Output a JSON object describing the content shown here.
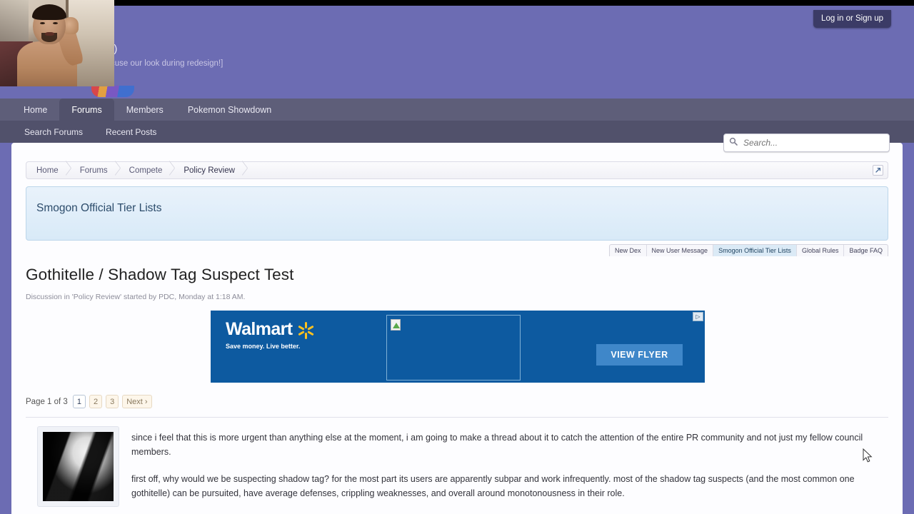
{
  "header": {
    "slogan": ":)",
    "sub_slogan": "cuse our look during redesign!]",
    "login_label": "Log in or Sign up"
  },
  "nav": {
    "tabs": [
      {
        "label": "Home",
        "active": false
      },
      {
        "label": "Forums",
        "active": true
      },
      {
        "label": "Members",
        "active": false
      },
      {
        "label": "Pokemon Showdown",
        "active": false
      }
    ],
    "subnav": [
      {
        "label": "Search Forums"
      },
      {
        "label": "Recent Posts"
      }
    ]
  },
  "search": {
    "placeholder": "Search...",
    "value": "",
    "icon": "search-icon"
  },
  "breadcrumb": {
    "items": [
      {
        "label": "Home"
      },
      {
        "label": "Forums"
      },
      {
        "label": "Compete"
      },
      {
        "label": "Policy Review"
      }
    ],
    "expand_icon": "external-link-icon"
  },
  "notice": {
    "title": "Smogon Official Tier Lists"
  },
  "tier_tabs": [
    {
      "label": "New Dex",
      "active": false
    },
    {
      "label": "New User Message",
      "active": false
    },
    {
      "label": "Smogon Official Tier Lists",
      "active": true
    },
    {
      "label": "Global Rules",
      "active": false
    },
    {
      "label": "Badge FAQ",
      "active": false
    }
  ],
  "thread": {
    "title": "Gothitelle / Shadow Tag Suspect Test",
    "meta": "Discussion in 'Policy Review' started by PDC, Monday at 1:18 AM."
  },
  "ad": {
    "brand": "Walmart",
    "tagline": "Save money. Live better.",
    "button_label": "VIEW FLYER",
    "adchoices_label": "▷",
    "brand_color": "#0d5aa0",
    "spark_color": "#ffc220"
  },
  "pagination": {
    "label": "Page 1 of 3",
    "pages": [
      {
        "label": "1",
        "active": true
      },
      {
        "label": "2",
        "active": false
      },
      {
        "label": "3",
        "active": false
      }
    ],
    "next_label": "Next ›"
  },
  "post": {
    "paragraph_1": "since i feel that this is more urgent than anything else at the moment, i am going to make a thread about it to catch the attention of the entire PR community and not just my fellow council members.",
    "paragraph_2": "first off, why would we be suspecting shadow tag? for the most part its users are apparently subpar and work infrequently. most of the shadow tag suspects (and the most common one gothitelle) can be pursuited, have average defenses, crippling weaknesses, and overall around monotonousness in their role."
  },
  "colors": {
    "header_purple": "#6c6cb3",
    "nav_dark": "#5e5e79",
    "subnav_dark": "#51516b",
    "notice_blue": "#d8eaf8"
  }
}
